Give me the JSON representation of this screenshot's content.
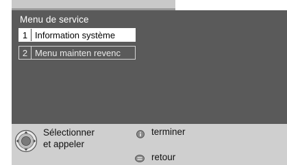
{
  "screen": {
    "title": "Menu de service"
  },
  "menu": {
    "items": [
      {
        "number": "1",
        "label": "Information système",
        "selected": true
      },
      {
        "number": "2",
        "label": "Menu mainten revenc",
        "selected": false
      }
    ]
  },
  "footer": {
    "select_line1": "Sélectionner",
    "select_line2": "et appeler",
    "exit_label": "terminer",
    "back_label": "retour",
    "icons": {
      "navigate": "dpad-ok-icon",
      "exit": "info-button-icon",
      "back": "return-button-icon"
    }
  },
  "colors": {
    "panel": "#5a5a5a",
    "footer": "#cfcfcf",
    "frame": "#9c9c9c",
    "selected_bg": "#ffffff"
  }
}
